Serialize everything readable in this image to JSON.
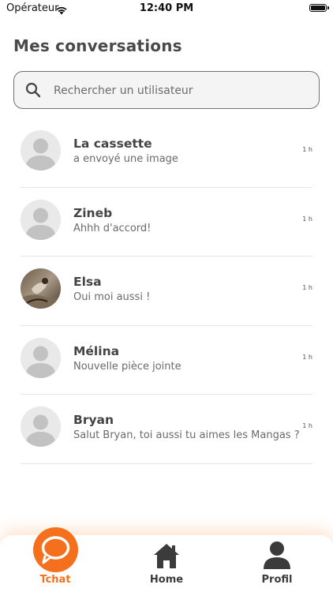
{
  "status_bar": {
    "carrier": "Opérateur",
    "time": "12:40 PM"
  },
  "header": {
    "title": "Mes conversations"
  },
  "search": {
    "placeholder": "Rechercher un utilisateur"
  },
  "conversations": [
    {
      "name": "La cassette",
      "preview": "a envoyé une image",
      "time": "1 h",
      "avatar": "default-avatar"
    },
    {
      "name": "Zineb",
      "preview": "Ahhh d'accord!",
      "time": "1 h",
      "avatar": "default-avatar"
    },
    {
      "name": "Elsa",
      "preview": "Oui moi aussi !",
      "time": "1 h",
      "avatar": "photo-avatar"
    },
    {
      "name": "Mélina",
      "preview": "Nouvelle pièce jointe",
      "time": "1 h",
      "avatar": "default-avatar"
    },
    {
      "name": "Bryan",
      "preview": "Salut Bryan, toi aussi tu aimes les Mangas ?",
      "time": "1 h",
      "avatar": "default-avatar"
    }
  ],
  "tabbar": {
    "tabs": [
      {
        "label": "Tchat",
        "icon": "chat-bubble-icon",
        "active": true
      },
      {
        "label": "Home",
        "icon": "home-icon",
        "active": false
      },
      {
        "label": "Profil",
        "icon": "person-icon",
        "active": false
      }
    ]
  },
  "colors": {
    "accent": "#f4701d",
    "text": "#444444",
    "search_bg": "#f4f4f4"
  }
}
